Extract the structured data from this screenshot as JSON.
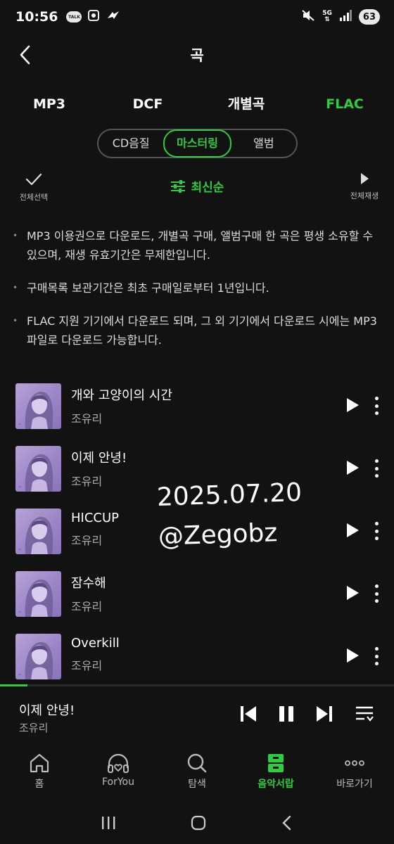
{
  "status_bar": {
    "time": "10:56",
    "talk_badge": "TALK",
    "network": "5G",
    "battery": "63"
  },
  "header": {
    "title": "곡"
  },
  "format_tabs": [
    {
      "label": "MP3",
      "active": false
    },
    {
      "label": "DCF",
      "active": false
    },
    {
      "label": "개별곡",
      "active": false
    },
    {
      "label": "FLAC",
      "active": true
    }
  ],
  "segments": [
    {
      "label": "CD음질",
      "active": false
    },
    {
      "label": "마스터링",
      "active": true
    },
    {
      "label": "앨범",
      "active": false
    }
  ],
  "toolbar": {
    "select_all": "전체선택",
    "sort": "최신순",
    "play_all": "전체재생"
  },
  "notices": [
    "MP3 이용권으로 다운로드, 개별곡 구매, 앨범구매 한 곡은 평생 소유할 수 있으며, 재생 유효기간은 무제한입니다.",
    "구매목록 보관기간은 최초 구매일로부터 1년입니다.",
    "FLAC 지원 기기에서 다운로드 되며, 그 외 기기에서 다운로드 시에는 MP3 파일로 다운로드 가능합니다."
  ],
  "songs": [
    {
      "title": "개와 고양이의 시간",
      "artist": "조유리"
    },
    {
      "title": "이제 안녕!",
      "artist": "조유리"
    },
    {
      "title": "HICCUP",
      "artist": "조유리"
    },
    {
      "title": "잠수해",
      "artist": "조유리"
    },
    {
      "title": "Overkill",
      "artist": "조유리"
    }
  ],
  "watermark": {
    "date": "2025.07.20",
    "handle": "@Zegobz"
  },
  "mini_player": {
    "title": "이제 안녕!",
    "artist": "조유리",
    "progress": 0.07
  },
  "bottom_nav": [
    {
      "label": "홈",
      "icon": "home-icon",
      "active": false
    },
    {
      "label": "ForYou",
      "icon": "headphones-heart-icon",
      "active": false
    },
    {
      "label": "탐색",
      "icon": "search-icon",
      "active": false
    },
    {
      "label": "음악서랍",
      "icon": "drawer-icon",
      "active": true
    },
    {
      "label": "바로가기",
      "icon": "more-dots-icon",
      "active": false
    }
  ],
  "colors": {
    "accent": "#2ecc40",
    "background": "#121212"
  }
}
